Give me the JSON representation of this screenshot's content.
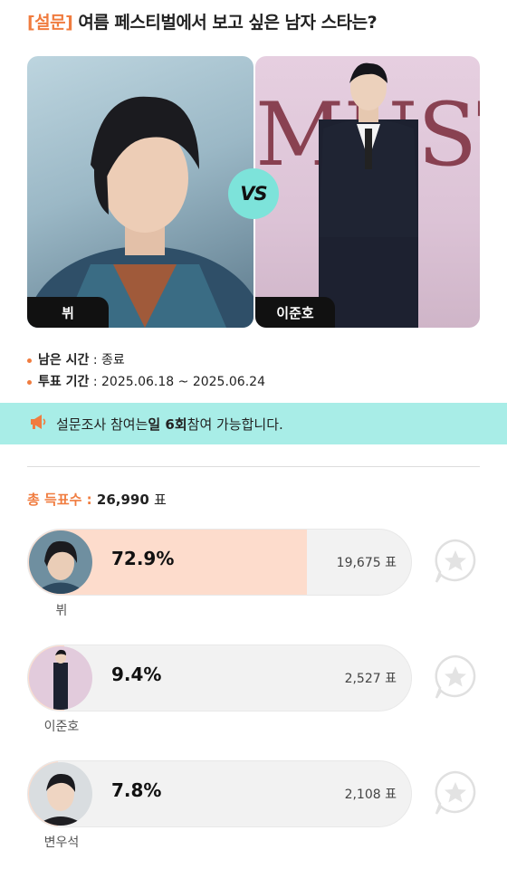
{
  "header": {
    "tag": "[설문]",
    "question": "여름 페스티벌에서 보고 싶은 남자 스타는?"
  },
  "matchup": {
    "left_name": "뷔",
    "right_name": "이준호",
    "vs": "VS"
  },
  "info": {
    "remaining_label": "남은 시간",
    "remaining_value": ": 종료",
    "period_label": "투표 기간",
    "period_value": ": 2025.06.18 ~ 2025.06.24"
  },
  "notice": {
    "pre": "설문조사 참여는 ",
    "bold": "일 6회",
    "post": " 참여 가능합니다."
  },
  "total": {
    "label": "총 득표수 :",
    "value": "26,990",
    "unit": "표"
  },
  "candidates": [
    {
      "name": "뷔",
      "percent_label": "72.9%",
      "percent": 72.9,
      "votes": "19,675 표"
    },
    {
      "name": "이준호",
      "percent_label": "9.4%",
      "percent": 9.4,
      "votes": "2,527 표"
    },
    {
      "name": "변우석",
      "percent_label": "7.8%",
      "percent": 7.8,
      "votes": "2,108 표"
    }
  ],
  "colors": {
    "accent": "#f07c3f",
    "notice_bg": "#a8ede7",
    "vs_bg": "#7de3da",
    "bar_fill": "#fddccc"
  }
}
